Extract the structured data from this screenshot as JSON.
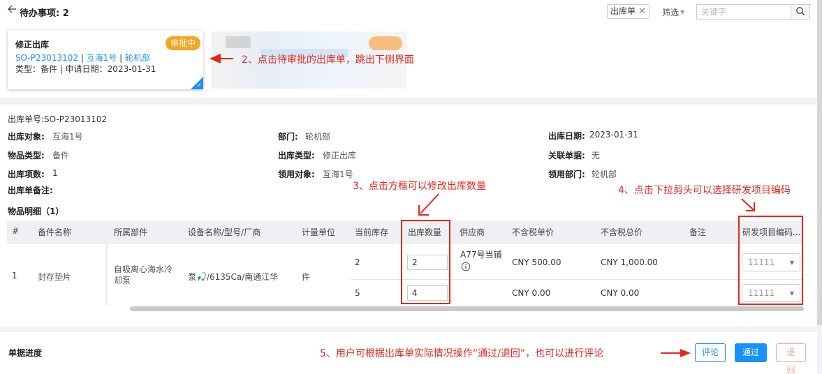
{
  "header": {
    "back_icon": "arrow-left-icon",
    "todo_title": "待办事项: 2",
    "filter_tag": "出库单",
    "filter_label": "筛选",
    "search_placeholder": "关键字"
  },
  "card": {
    "title": "修正出库",
    "badge": "审批中",
    "order_no": "SO-P23013102",
    "object": "互海1号",
    "department": "轮机部",
    "meta": "类型：备件 | 申请日期：2023-01-31"
  },
  "annotations": {
    "a2": "2、点击待审批的出库单，跳出下侧界面",
    "a3": "3、点击方框可以修改出库数量",
    "a4": "4、点击下拉剪头可以选择研发项目编码",
    "a5": "5、用户可根据出库单实际情况操作“通过/退回”，也可以进行评论"
  },
  "detail": {
    "order_no": "出库单号:SO-P23013102",
    "fields": {
      "object_label": "出库对象:",
      "object_value": "互海1号",
      "dept_label": "部门:",
      "dept_value": "轮机部",
      "date_label": "出库日期:",
      "date_value": "2023-01-31",
      "type_label": "物品类型:",
      "type_value": "备件",
      "out_type_label": "出库类型:",
      "out_type_value": "修正出库",
      "related_label": "关联单据:",
      "related_value": "无",
      "count_label": "出库项数:",
      "count_value": "1",
      "recv_obj_label": "领用对象:",
      "recv_obj_value": "互海1号",
      "recv_dept_label": "领用部门:",
      "recv_dept_value": "轮机部",
      "remark_label": "出库单备注:"
    },
    "items_title": "物品明细（1）"
  },
  "table": {
    "headers": [
      "#",
      "备件名称",
      "所属部件",
      "设备名称/型号/厂商",
      "计量单位",
      "当前库存",
      "出库数量",
      "供应商",
      "不含税单价",
      "不含税总价",
      "备注",
      "研发项目编码..."
    ],
    "row": {
      "index": "1",
      "name": "封存垫片",
      "component_line1": "自吸离心海水冷",
      "component_line2": "却泵",
      "equipment": "泵🎣/6135Ca/南通江华",
      "unit": "件",
      "supplier": "A77号当铺",
      "sub": [
        {
          "stock": "2",
          "qty": "2",
          "unit_price": "CNY 500.00",
          "total": "CNY 1,000.00",
          "project_code": "11111"
        },
        {
          "stock": "5",
          "qty": "4",
          "unit_price": "CNY 0.00",
          "total": "CNY 0.00",
          "project_code": "11111"
        }
      ]
    }
  },
  "footer": {
    "progress_title": "单据进度",
    "comment": "评论",
    "pass": "通过",
    "reject": "退回"
  },
  "colors": {
    "primary": "#1890ff",
    "badge": "#f5a623",
    "annotation": "#e8261d",
    "reject": "#f3a99b"
  }
}
